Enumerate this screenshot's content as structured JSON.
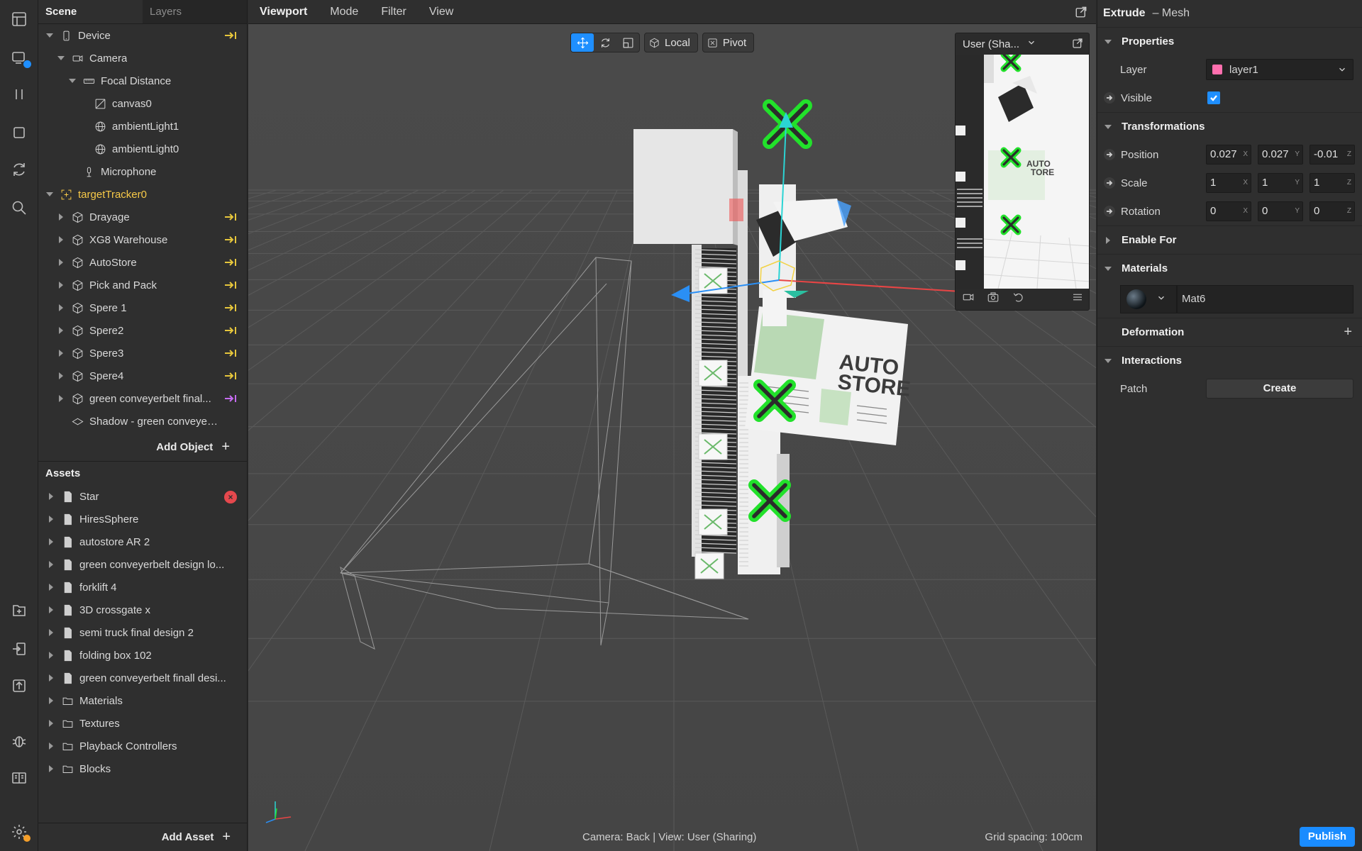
{
  "scene_panel": {
    "tabs": [
      "Scene",
      "Layers"
    ],
    "tree": [
      {
        "label": "Device",
        "indent": 0,
        "caret": "down",
        "icon": "phone-icon",
        "arrow": "yellow"
      },
      {
        "label": "Camera",
        "indent": 1,
        "caret": "down",
        "icon": "camera-icon"
      },
      {
        "label": "Focal Distance",
        "indent": 2,
        "caret": "down",
        "icon": "ruler-icon"
      },
      {
        "label": "canvas0",
        "indent": 3,
        "caret": "none",
        "icon": "canvas-icon"
      },
      {
        "label": "ambientLight1",
        "indent": 3,
        "caret": "none",
        "icon": "globe-icon"
      },
      {
        "label": "ambientLight0",
        "indent": 3,
        "caret": "none",
        "icon": "globe-icon"
      },
      {
        "label": "Microphone",
        "indent": 2,
        "caret": "none",
        "icon": "microphone-icon"
      },
      {
        "label": "targetTracker0",
        "indent": 0,
        "caret": "down",
        "icon": "target-tracker-icon",
        "selected": true
      },
      {
        "label": "Drayage",
        "indent": 1,
        "caret": "right",
        "icon": "cube-icon",
        "arrow": "yellow"
      },
      {
        "label": "XG8 Warehouse",
        "indent": 1,
        "caret": "right",
        "icon": "cube-icon",
        "arrow": "yellow"
      },
      {
        "label": "AutoStore",
        "indent": 1,
        "caret": "right",
        "icon": "cube-icon",
        "arrow": "yellow"
      },
      {
        "label": "Pick and Pack",
        "indent": 1,
        "caret": "right",
        "icon": "cube-icon",
        "arrow": "yellow"
      },
      {
        "label": "Spere 1",
        "indent": 1,
        "caret": "right",
        "icon": "cube-icon",
        "arrow": "yellow"
      },
      {
        "label": "Spere2",
        "indent": 1,
        "caret": "right",
        "icon": "cube-icon",
        "arrow": "yellow"
      },
      {
        "label": "Spere3",
        "indent": 1,
        "caret": "right",
        "icon": "cube-icon",
        "arrow": "yellow"
      },
      {
        "label": "Spere4",
        "indent": 1,
        "caret": "right",
        "icon": "cube-icon",
        "arrow": "yellow"
      },
      {
        "label": "green conveyerbelt final...",
        "indent": 1,
        "caret": "right",
        "icon": "cube-icon",
        "arrow": "purple"
      },
      {
        "label": "Shadow - green conveyerb...",
        "indent": 1,
        "caret": "none",
        "icon": "plane-icon"
      }
    ],
    "add_object": "Add Object",
    "assets_title": "Assets",
    "assets": [
      {
        "label": "Star",
        "icon": "file-icon",
        "error": "×"
      },
      {
        "label": "HiresSphere",
        "icon": "file-icon"
      },
      {
        "label": "autostore AR 2",
        "icon": "file-icon"
      },
      {
        "label": "green conveyerbelt design lo...",
        "icon": "file-icon"
      },
      {
        "label": "forklift 4",
        "icon": "file-icon"
      },
      {
        "label": "3D crossgate x",
        "icon": "file-icon"
      },
      {
        "label": "semi truck final design 2",
        "icon": "file-icon"
      },
      {
        "label": "folding box 102",
        "icon": "file-icon"
      },
      {
        "label": "green conveyerbelt finall desi...",
        "icon": "file-icon"
      },
      {
        "label": "Materials",
        "icon": "folder-icon"
      },
      {
        "label": "Textures",
        "icon": "folder-icon"
      },
      {
        "label": "Playback Controllers",
        "icon": "folder-icon"
      },
      {
        "label": "Blocks",
        "icon": "folder-icon"
      }
    ],
    "add_asset": "Add Asset"
  },
  "viewport": {
    "menus": [
      "Viewport",
      "Mode",
      "Filter",
      "View"
    ],
    "toolbar": {
      "local_label": "Local",
      "pivot_label": "Pivot"
    },
    "preview_title": "User (Sha...",
    "poster_text": [
      "AUTO",
      "STORE"
    ],
    "preview_poster_text": [
      "AUTO",
      "TORE"
    ],
    "status_camera": "Camera: Back | View: User (Sharing)",
    "status_grid": "Grid spacing: 100cm"
  },
  "inspector": {
    "title": "Extrude",
    "subtitle": "– Mesh",
    "sections": {
      "properties": "Properties",
      "transformations": "Transformations",
      "enable_for": "Enable For",
      "materials": "Materials",
      "deformation": "Deformation",
      "interactions": "Interactions"
    },
    "layer_label": "Layer",
    "layer_value": "layer1",
    "layer_color": "#ff6fae",
    "visible_label": "Visible",
    "visible_checked": true,
    "position_label": "Position",
    "position": [
      "0.027",
      "0.027",
      "-0.01"
    ],
    "scale_label": "Scale",
    "scale": [
      "1",
      "1",
      "1"
    ],
    "rotation_label": "Rotation",
    "rotation": [
      "0",
      "0",
      "0"
    ],
    "axes": [
      "X",
      "Y",
      "Z"
    ],
    "material_name": "Mat6",
    "patch_label": "Patch",
    "create_label": "Create",
    "publish_label": "Publish"
  },
  "colors": {
    "accent": "#1f8fff",
    "selected_text": "#f7c948",
    "arrow_yellow": "#e6c63c",
    "arrow_purple": "#c56cf0",
    "error": "#e5484d",
    "gizmo_green": "#22e12b"
  }
}
